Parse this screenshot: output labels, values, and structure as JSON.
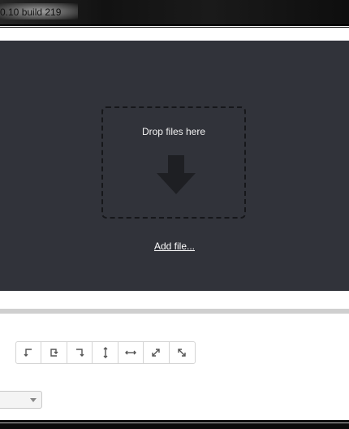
{
  "window": {
    "title": "0.10 build 219"
  },
  "dropzone": {
    "drop_text": "Drop files here",
    "add_file_label": "Add file..."
  },
  "toolbar": {
    "tools": [
      {
        "name": "rotate-left-icon"
      },
      {
        "name": "rotate-back-icon"
      },
      {
        "name": "rotate-right-icon"
      },
      {
        "name": "flip-vertical-icon"
      },
      {
        "name": "flip-horizontal-icon"
      },
      {
        "name": "expand-diagonal-icon"
      },
      {
        "name": "shrink-diagonal-icon"
      }
    ]
  },
  "select": {
    "value": ""
  },
  "colors": {
    "dropzone_bg": "#31333a",
    "text_light": "#f2f2f2",
    "separator": "#cfcfcf"
  }
}
